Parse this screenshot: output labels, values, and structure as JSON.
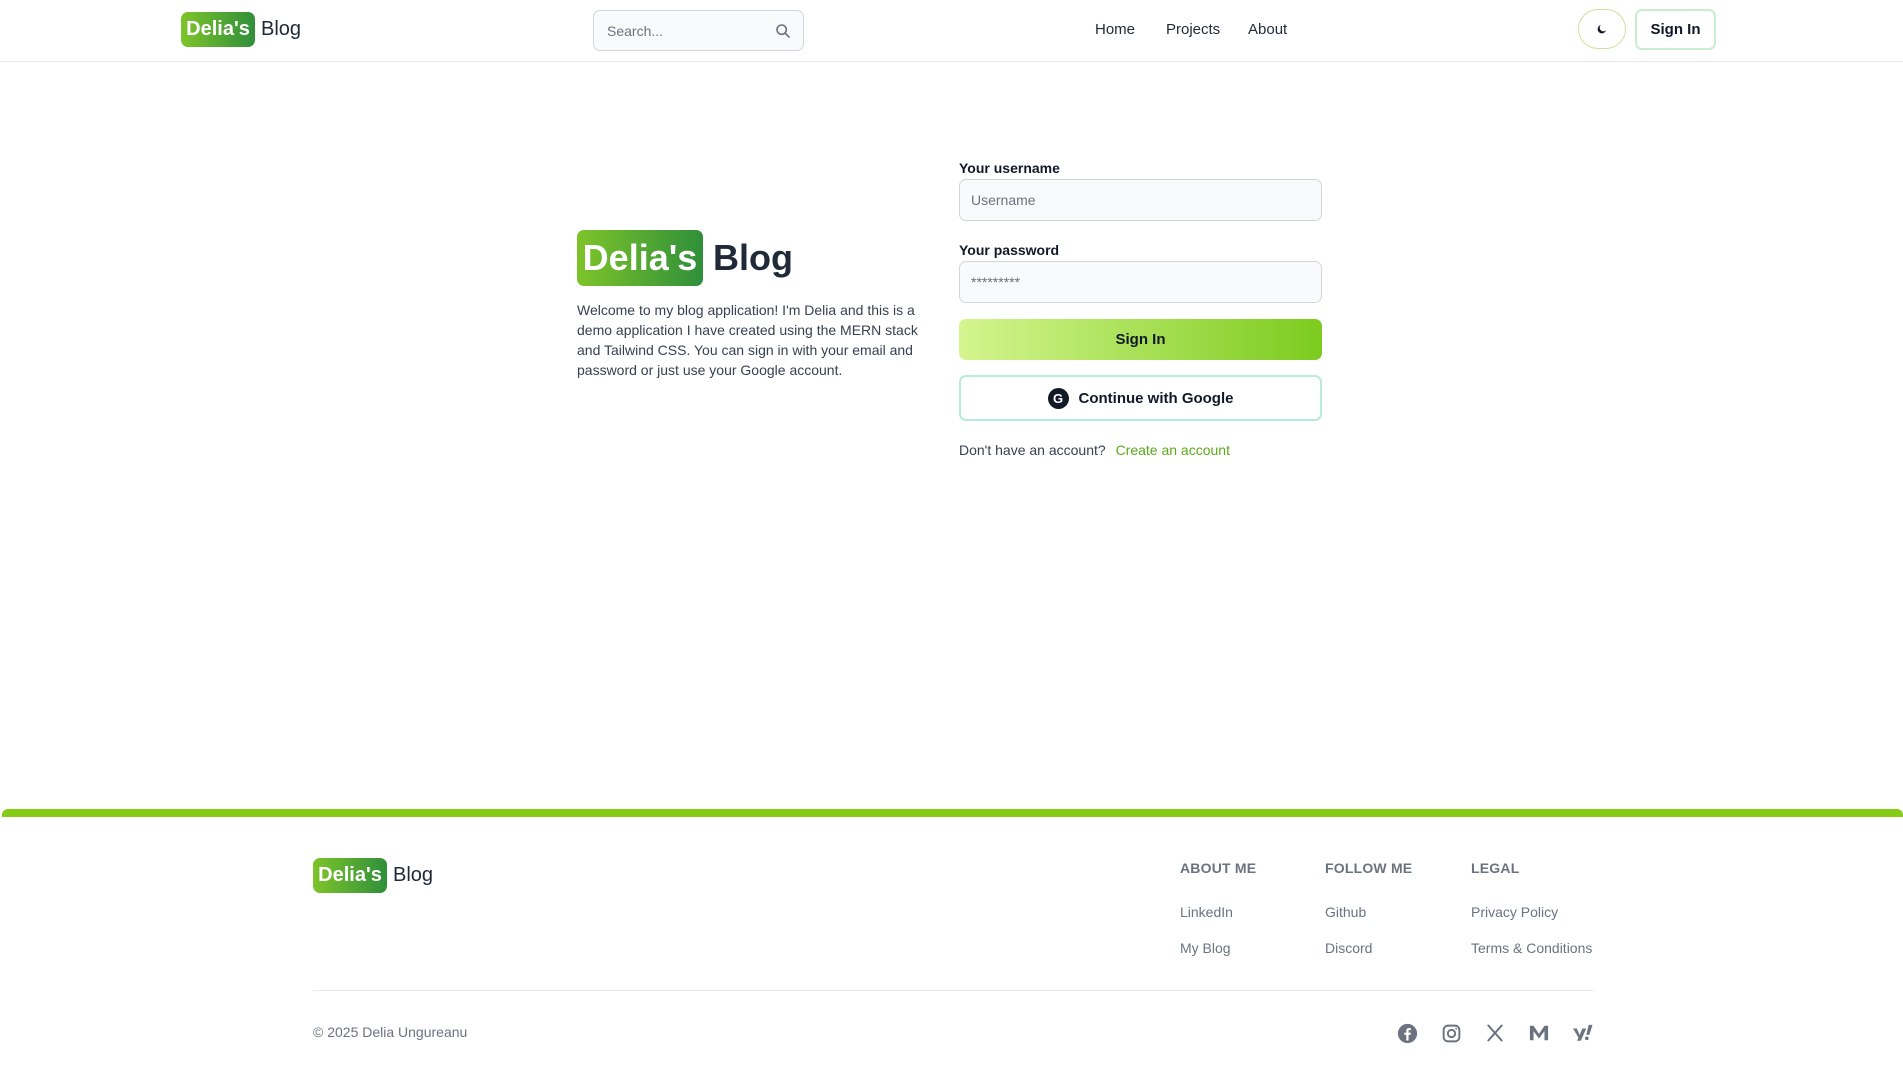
{
  "header": {
    "logo_badge": "Delia's",
    "logo_text": "Blog",
    "search_placeholder": "Search...",
    "nav": [
      "Home",
      "Projects",
      "About"
    ],
    "signin_label": "Sign In"
  },
  "intro": {
    "logo_badge": "Delia's",
    "logo_text": "Blog",
    "welcome": "Welcome to my blog application! I'm Delia and this is a demo application I have created using the MERN stack and Tailwind CSS. You can sign in with your email and password or just use your Google account."
  },
  "form": {
    "username_label": "Your username",
    "username_placeholder": "Username",
    "password_label": "Your password",
    "password_placeholder": "*********",
    "signin_label": "Sign In",
    "google_label": "Continue with Google",
    "google_letter": "G",
    "no_account_text": "Don't have an account?",
    "create_account_label": "Create an account"
  },
  "footer": {
    "logo_badge": "Delia's",
    "logo_text": "Blog",
    "columns": [
      {
        "heading": "ABOUT ME",
        "links": [
          "LinkedIn",
          "My Blog"
        ]
      },
      {
        "heading": "FOLLOW ME",
        "links": [
          "Github",
          "Discord"
        ]
      },
      {
        "heading": "LEGAL",
        "links": [
          "Privacy Policy",
          "Terms & Conditions"
        ]
      }
    ],
    "copyright": "© 2025 Delia Ungureanu",
    "social_icons": [
      "facebook-icon",
      "instagram-icon",
      "x-icon",
      "medium-icon",
      "yahoo-icon"
    ]
  },
  "colors": {
    "accent": "#84cc16",
    "logo_gradient_start": "#7ec42a",
    "logo_gradient_end": "#2f8f3a",
    "link": "#5ca91a"
  }
}
